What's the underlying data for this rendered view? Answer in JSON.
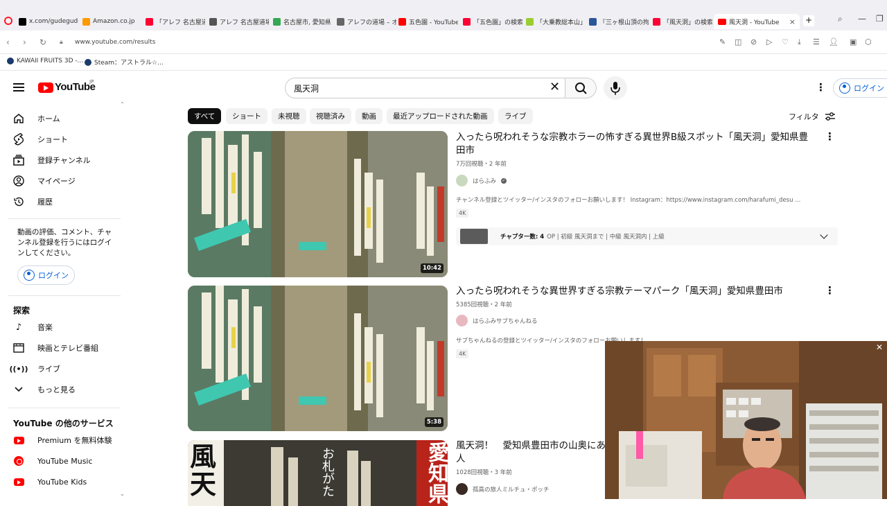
{
  "browser": {
    "tabs": [
      {
        "label": "x.com/gudegude",
        "color": "#000000"
      },
      {
        "label": "Amazon.co.jp",
        "color": "#ff9900"
      },
      {
        "label": "「アレフ 名古屋道場",
        "color": "#ff0033"
      },
      {
        "label": "アレフ 名古屋道場",
        "color": "#555555"
      },
      {
        "label": "名古屋市, 愛知県",
        "color": "#34a853"
      },
      {
        "label": "アレフの道場 – オウ",
        "color": "#666666"
      },
      {
        "label": "五色園 - YouTube",
        "color": "#ff0000"
      },
      {
        "label": "「五色園」の検索結",
        "color": "#ff0033"
      },
      {
        "label": "「大乗教総本山」の",
        "color": "#9acd32"
      },
      {
        "label": "『三ヶ根山頂の拘図",
        "color": "#2b579a"
      },
      {
        "label": "「風天洞」の検索結",
        "color": "#ff0033"
      }
    ],
    "active_tab": "風天洞 - YouTube",
    "url": "www.youtube.com/results",
    "bookmarks": [
      "KAWAII FRUITS 3D -...",
      "Steam：アストラル☆..."
    ]
  },
  "header": {
    "logo": "YouTube",
    "region": "JP",
    "search_value": "風天洞",
    "signin": "ログイン"
  },
  "sidebar": {
    "items": [
      {
        "label": "ホーム",
        "icon": "home-icon"
      },
      {
        "label": "ショート",
        "icon": "shorts-icon"
      },
      {
        "label": "登録チャンネル",
        "icon": "subscriptions-icon"
      },
      {
        "label": "マイページ",
        "icon": "you-icon"
      },
      {
        "label": "履歴",
        "icon": "history-icon"
      }
    ],
    "signin_message": "動画の評価、コメント、チャンネル登録を行うにはログインしてください。",
    "signin_button": "ログイン",
    "explore_heading": "探索",
    "explore": [
      {
        "label": "音楽",
        "icon": "music-icon"
      },
      {
        "label": "映画とテレビ番組",
        "icon": "film-icon"
      },
      {
        "label": "ライブ",
        "icon": "live-icon"
      },
      {
        "label": "もっと見る",
        "icon": "chevron-down-icon"
      }
    ],
    "more_heading": "YouTube の他のサービス",
    "more": [
      {
        "label": "Premium を無料体験"
      },
      {
        "label": "YouTube Music"
      },
      {
        "label": "YouTube Kids"
      }
    ]
  },
  "chips": [
    "すべて",
    "ショート",
    "未視聴",
    "視聴済み",
    "動画",
    "最近アップロードされた動画",
    "ライブ"
  ],
  "filter_label": "フィルタ",
  "videos": [
    {
      "title": "入ったら呪われそうな宗教ホラーの怖すぎる異世界B級スポット「風天洞」愛知県豊田市",
      "meta": "7万回視聴・2 年前",
      "channel": "はらふみ",
      "description": "チャンネル登録とツイッター/インスタのフォローお願いします！ Instagram：https://www.instagram.com/harafumi_desu ...",
      "badge": "4K",
      "duration": "10:42",
      "chapters_label": "チャプター数: 4",
      "chapters_text": "OP | 初級 風天洞まで | 中級 風天洞内 | 上級"
    },
    {
      "title": "入ったら呪われそうな異世界すぎる宗教テーマパーク「風天洞」愛知県豊田市",
      "meta": "5385回視聴・2 年前",
      "channel": "はらふみサブちゃんねる",
      "description": "サブちゃんねるの登録とツイッター/インスタのフォローお願いします！",
      "badge": "4K",
      "duration": "5:38"
    },
    {
      "title": "風天洞！　愛知県豊田市の山奥にあ",
      "title_line2": "人",
      "meta": "1028回視聴・3 年前",
      "channel": "孤高の旅人ミルチュ・ポッチ",
      "thumb_text_left": "風天",
      "thumb_text_mid": "お札がた",
      "thumb_text_right": "愛知県"
    }
  ]
}
